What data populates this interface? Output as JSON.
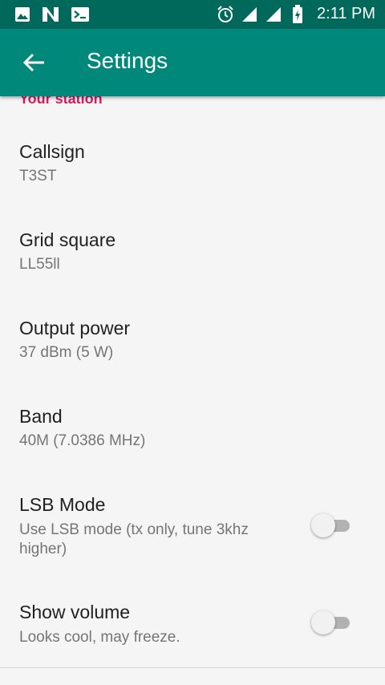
{
  "status_bar": {
    "time": "2:11 PM",
    "left_icons": [
      "image-icon",
      "n-notification-icon",
      "terminal-icon"
    ],
    "right_icons": [
      "alarm-icon",
      "signal-icon",
      "signal-icon",
      "battery-charging-icon"
    ]
  },
  "app_bar": {
    "title": "Settings",
    "back_icon": "arrow-back-icon"
  },
  "section": {
    "header": "Your station"
  },
  "prefs": {
    "callsign": {
      "title": "Callsign",
      "summary": "T3ST"
    },
    "grid": {
      "title": "Grid square",
      "summary": "LL55ll"
    },
    "power": {
      "title": "Output power",
      "summary": "37 dBm (5 W)"
    },
    "band": {
      "title": "Band",
      "summary": "40M (7.0386 MHz)"
    },
    "lsb": {
      "title": "LSB Mode",
      "summary_line1": "Use LSB mode (tx only, tune 3khz",
      "summary_line2": "higher)",
      "enabled": false
    },
    "volume": {
      "title": "Show volume",
      "summary": "Looks cool, may freeze.",
      "enabled": false
    }
  },
  "colors": {
    "status_bar": "#00695c",
    "app_bar": "#00897b",
    "accent": "#d81b60"
  }
}
